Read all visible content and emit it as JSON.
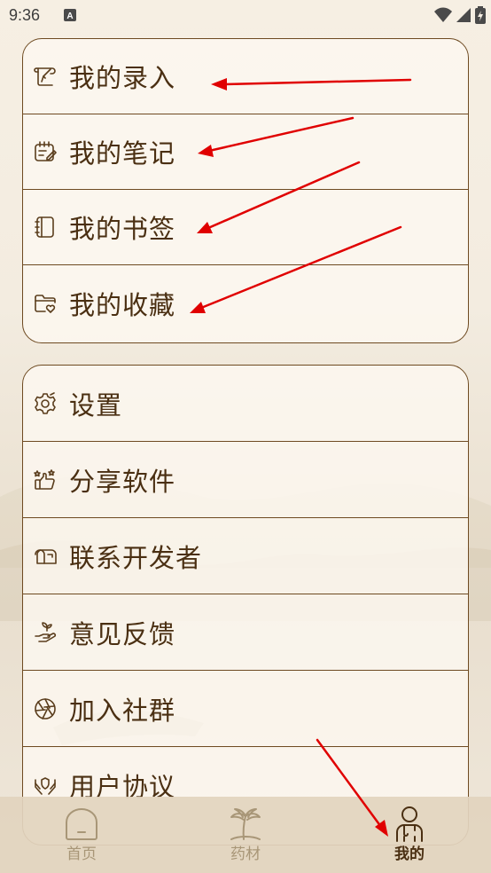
{
  "status_bar": {
    "time": "9:36"
  },
  "personal_menu": {
    "items": [
      {
        "label": "我的录入",
        "icon": "scroll-edit-icon"
      },
      {
        "label": "我的笔记",
        "icon": "notepad-icon"
      },
      {
        "label": "我的书签",
        "icon": "notebook-icon"
      },
      {
        "label": "我的收藏",
        "icon": "folder-heart-icon"
      }
    ]
  },
  "settings_menu": {
    "items": [
      {
        "label": "设置",
        "icon": "gear-icon"
      },
      {
        "label": "分享软件",
        "icon": "thumbs-up-stars-icon"
      },
      {
        "label": "联系开发者",
        "icon": "mailbox-icon"
      },
      {
        "label": "意见反馈",
        "icon": "hand-sprout-icon"
      },
      {
        "label": "加入社群",
        "icon": "aperture-icon"
      },
      {
        "label": "用户协议",
        "icon": "hands-shield-icon"
      }
    ]
  },
  "tabbar": {
    "tabs": [
      {
        "label": "首页",
        "icon": "home-icon",
        "active": false
      },
      {
        "label": "药材",
        "icon": "palm-tree-icon",
        "active": false
      },
      {
        "label": "我的",
        "icon": "person-icon",
        "active": true
      }
    ]
  },
  "colors": {
    "accent_brown": "#4a2f12",
    "border_brown": "#6e4a21",
    "annotation_red": "#e00000",
    "tab_inactive": "#a89677"
  }
}
